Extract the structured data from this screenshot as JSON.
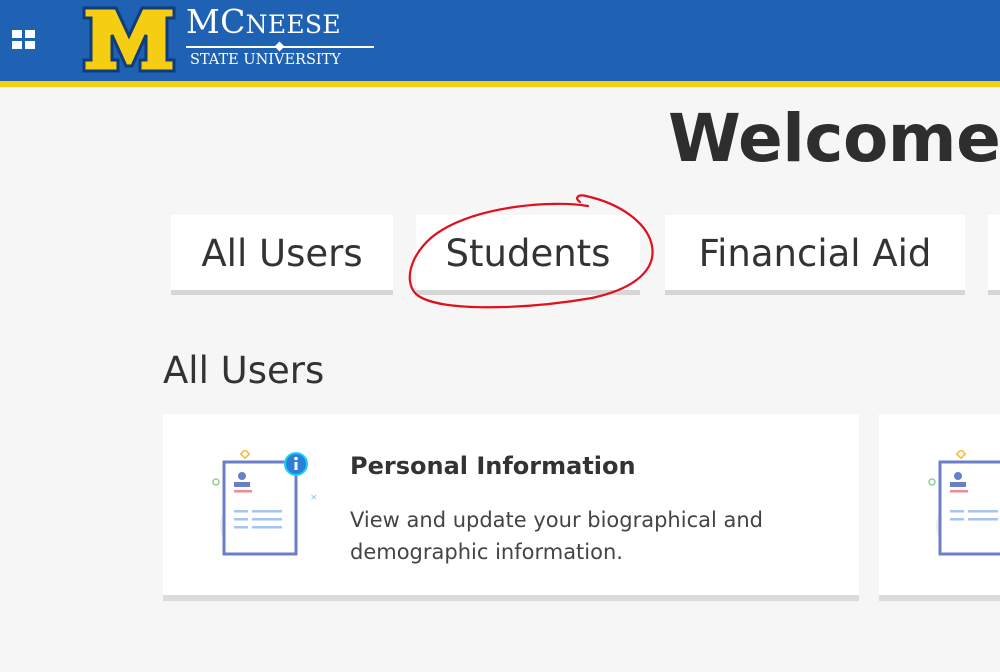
{
  "header": {
    "logo_name_big": "MC",
    "logo_name_small": "NEESE",
    "logo_name_full": "McNeese",
    "logo_subtitle": "STATE UNIVERSITY",
    "bar_color": "#1f62b4",
    "stripe_color": "#f5cd12"
  },
  "main": {
    "welcome": "Welcome",
    "tabs": [
      {
        "label": "All Users"
      },
      {
        "label": "Students"
      },
      {
        "label": "Financial Aid"
      }
    ],
    "section_title": "All Users",
    "cards": [
      {
        "title": "Personal Information",
        "description": "View and update your biographical and demographic information.",
        "icon": "profile-document-icon"
      },
      {
        "title": "",
        "description": "",
        "icon": "profile-document-icon"
      }
    ]
  },
  "annotation": {
    "color": "#e0101c",
    "target": "Students"
  }
}
